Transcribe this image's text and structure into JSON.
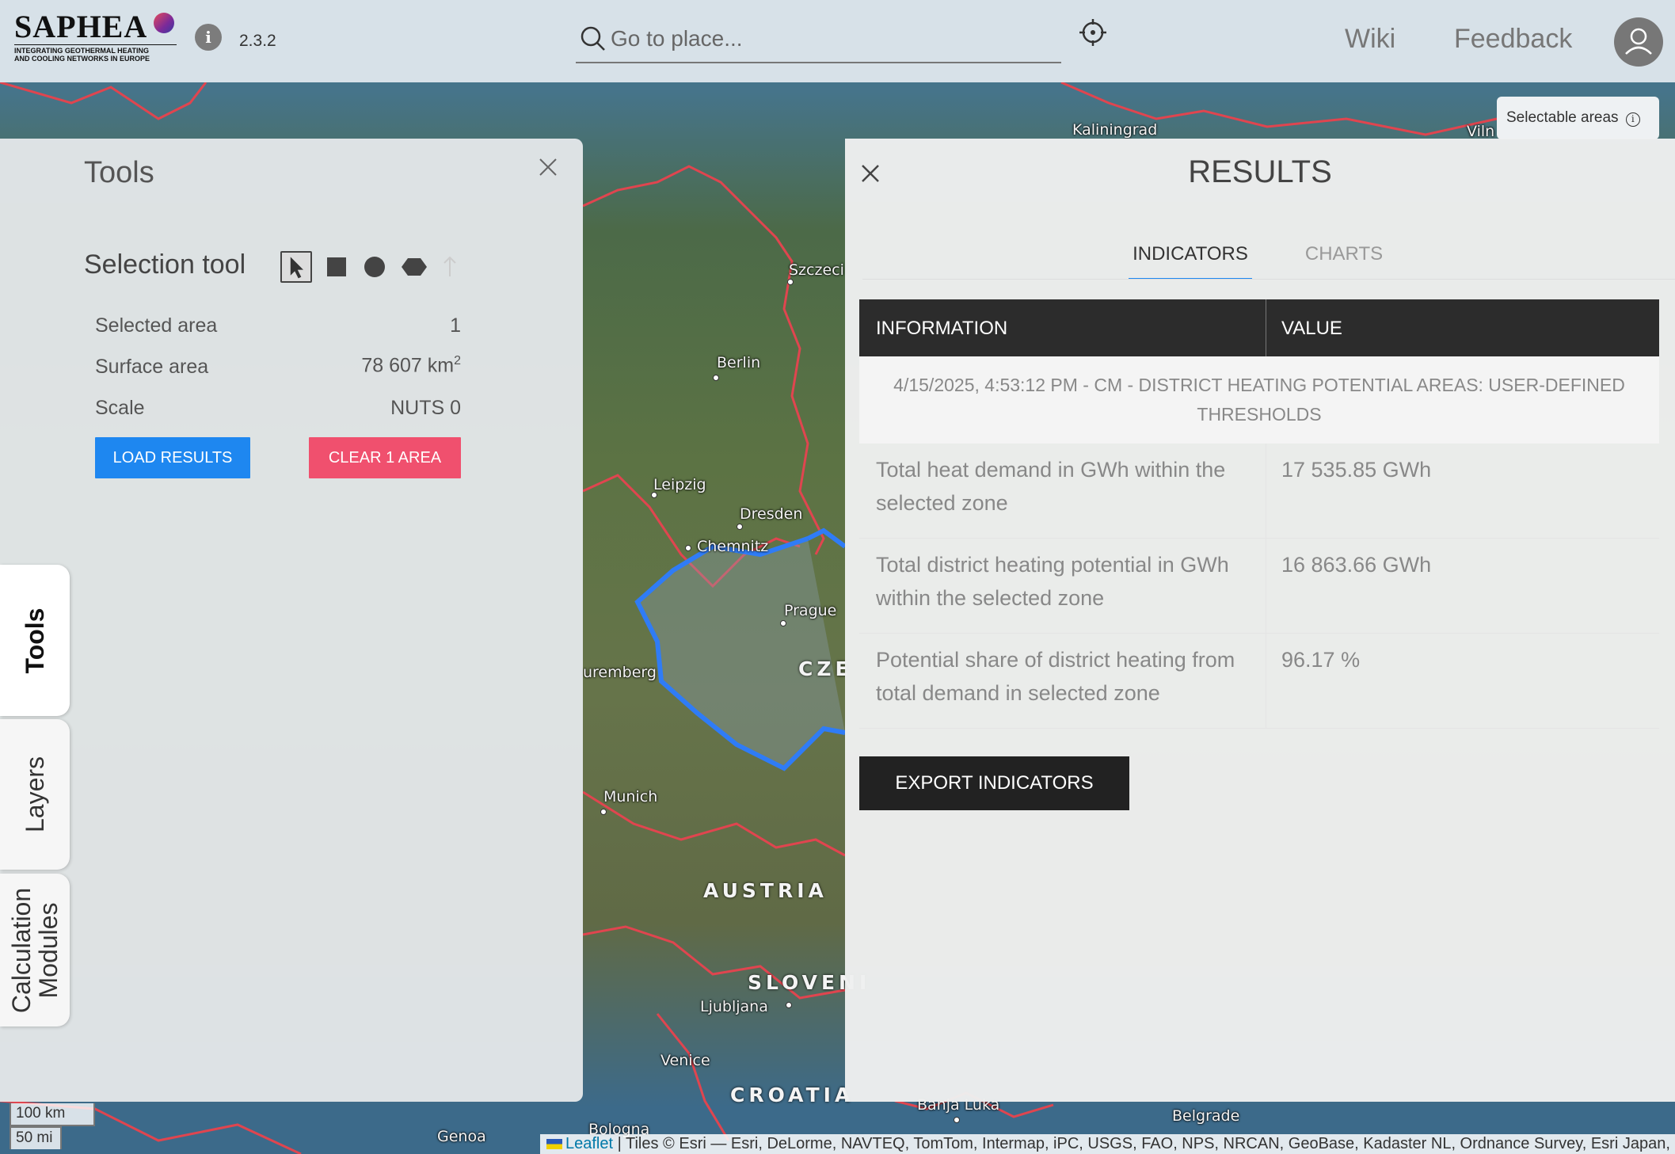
{
  "header": {
    "logo_text": "SAPHEA",
    "logo_tagline_1": "INTEGRATING GEOTHERMAL HEATING",
    "logo_tagline_2": "AND COOLING NETWORKS IN EUROPE",
    "info_icon": "i",
    "version": "2.3.2",
    "search_placeholder": "Go to place...",
    "wiki_label": "Wiki",
    "feedback_label": "Feedback"
  },
  "map": {
    "selectable_areas_label": "Selectable areas",
    "cities": [
      "Kaliningrad",
      "Szczecin",
      "Berlin",
      "Leipzig",
      "Dresden",
      "Chemnitz",
      "Prague",
      "Nuremberg",
      "Munich",
      "Ljubljana",
      "Venice",
      "Genoa",
      "Bologna",
      "Banja Luka",
      "Belgrade",
      "Vilnius"
    ],
    "countries": [
      "CZECHIA",
      "AUSTRIA",
      "SLOVENIA",
      "CROATIA"
    ],
    "city_labels": {
      "kaliningrad": "Kaliningrad",
      "szczecin": "Szczeci",
      "berlin": "Berlin",
      "leipzig": "Leipzig",
      "dresden": "Dresden",
      "chemnitz": "Chemnitz",
      "prague": "Prague",
      "nuremberg": "uremberg",
      "munich": "Munich",
      "ljubljana": "Ljubljana",
      "venice": "Venice",
      "genoa": "Genoa",
      "bologna": "Bologna",
      "banja_luka": "Banja Luka",
      "belgrade": "Belgrade",
      "vilnius": "Viln"
    },
    "country_labels": {
      "czechia": "CZE",
      "austria": "AUSTRIA",
      "slovenia": "SLOVENI",
      "croatia": "CROATIA"
    },
    "scale_km": "100 km",
    "scale_mi": "50 mi",
    "attribution_leaflet": "Leaflet",
    "attribution_text": "| Tiles © Esri — Esri, DeLorme, NAVTEQ, TomTom, Intermap, iPC, USGS, FAO, NPS, NRCAN, GeoBase, Kadaster NL, Ordnance Survey, Esri Japan,",
    "selection_color": "#2f7cf6",
    "border_color": "#e0454f"
  },
  "tools_panel": {
    "title": "Tools",
    "selection_tool_label": "Selection tool",
    "tools": [
      "pointer-icon",
      "square-icon",
      "circle-icon",
      "hexagon-icon",
      "upload-icon"
    ],
    "rows": [
      {
        "label": "Selected area",
        "value": "1"
      },
      {
        "label": "Surface area",
        "value": "78 607 km",
        "sup": "2"
      },
      {
        "label": "Scale",
        "value": "NUTS 0"
      }
    ],
    "load_button": "LOAD RESULTS",
    "clear_button": "CLEAR 1 AREA",
    "load_color": "#1e87f0",
    "clear_color": "#f0506e"
  },
  "side_tabs": {
    "tools": "Tools",
    "layers": "Layers",
    "cm_line1": "Calculation",
    "cm_line2": "Modules"
  },
  "results_panel": {
    "title": "RESULTS",
    "tabs": [
      "INDICATORS",
      "CHARTS"
    ],
    "active_tab": "INDICATORS",
    "table_headers": [
      "INFORMATION",
      "VALUE"
    ],
    "run_title": "4/15/2025, 4:53:12 PM - CM - DISTRICT HEATING POTENTIAL AREAS: USER-DEFINED THRESHOLDS",
    "rows": [
      {
        "label": "Total heat demand in GWh within the selected zone",
        "value": "17 535.85 GWh"
      },
      {
        "label": "Total district heating potential in GWh within the selected zone",
        "value": "16 863.66 GWh"
      },
      {
        "label": "Potential share of district heating from total demand in selected zone",
        "value": "96.17 %"
      }
    ],
    "export_button": "EXPORT INDICATORS"
  }
}
